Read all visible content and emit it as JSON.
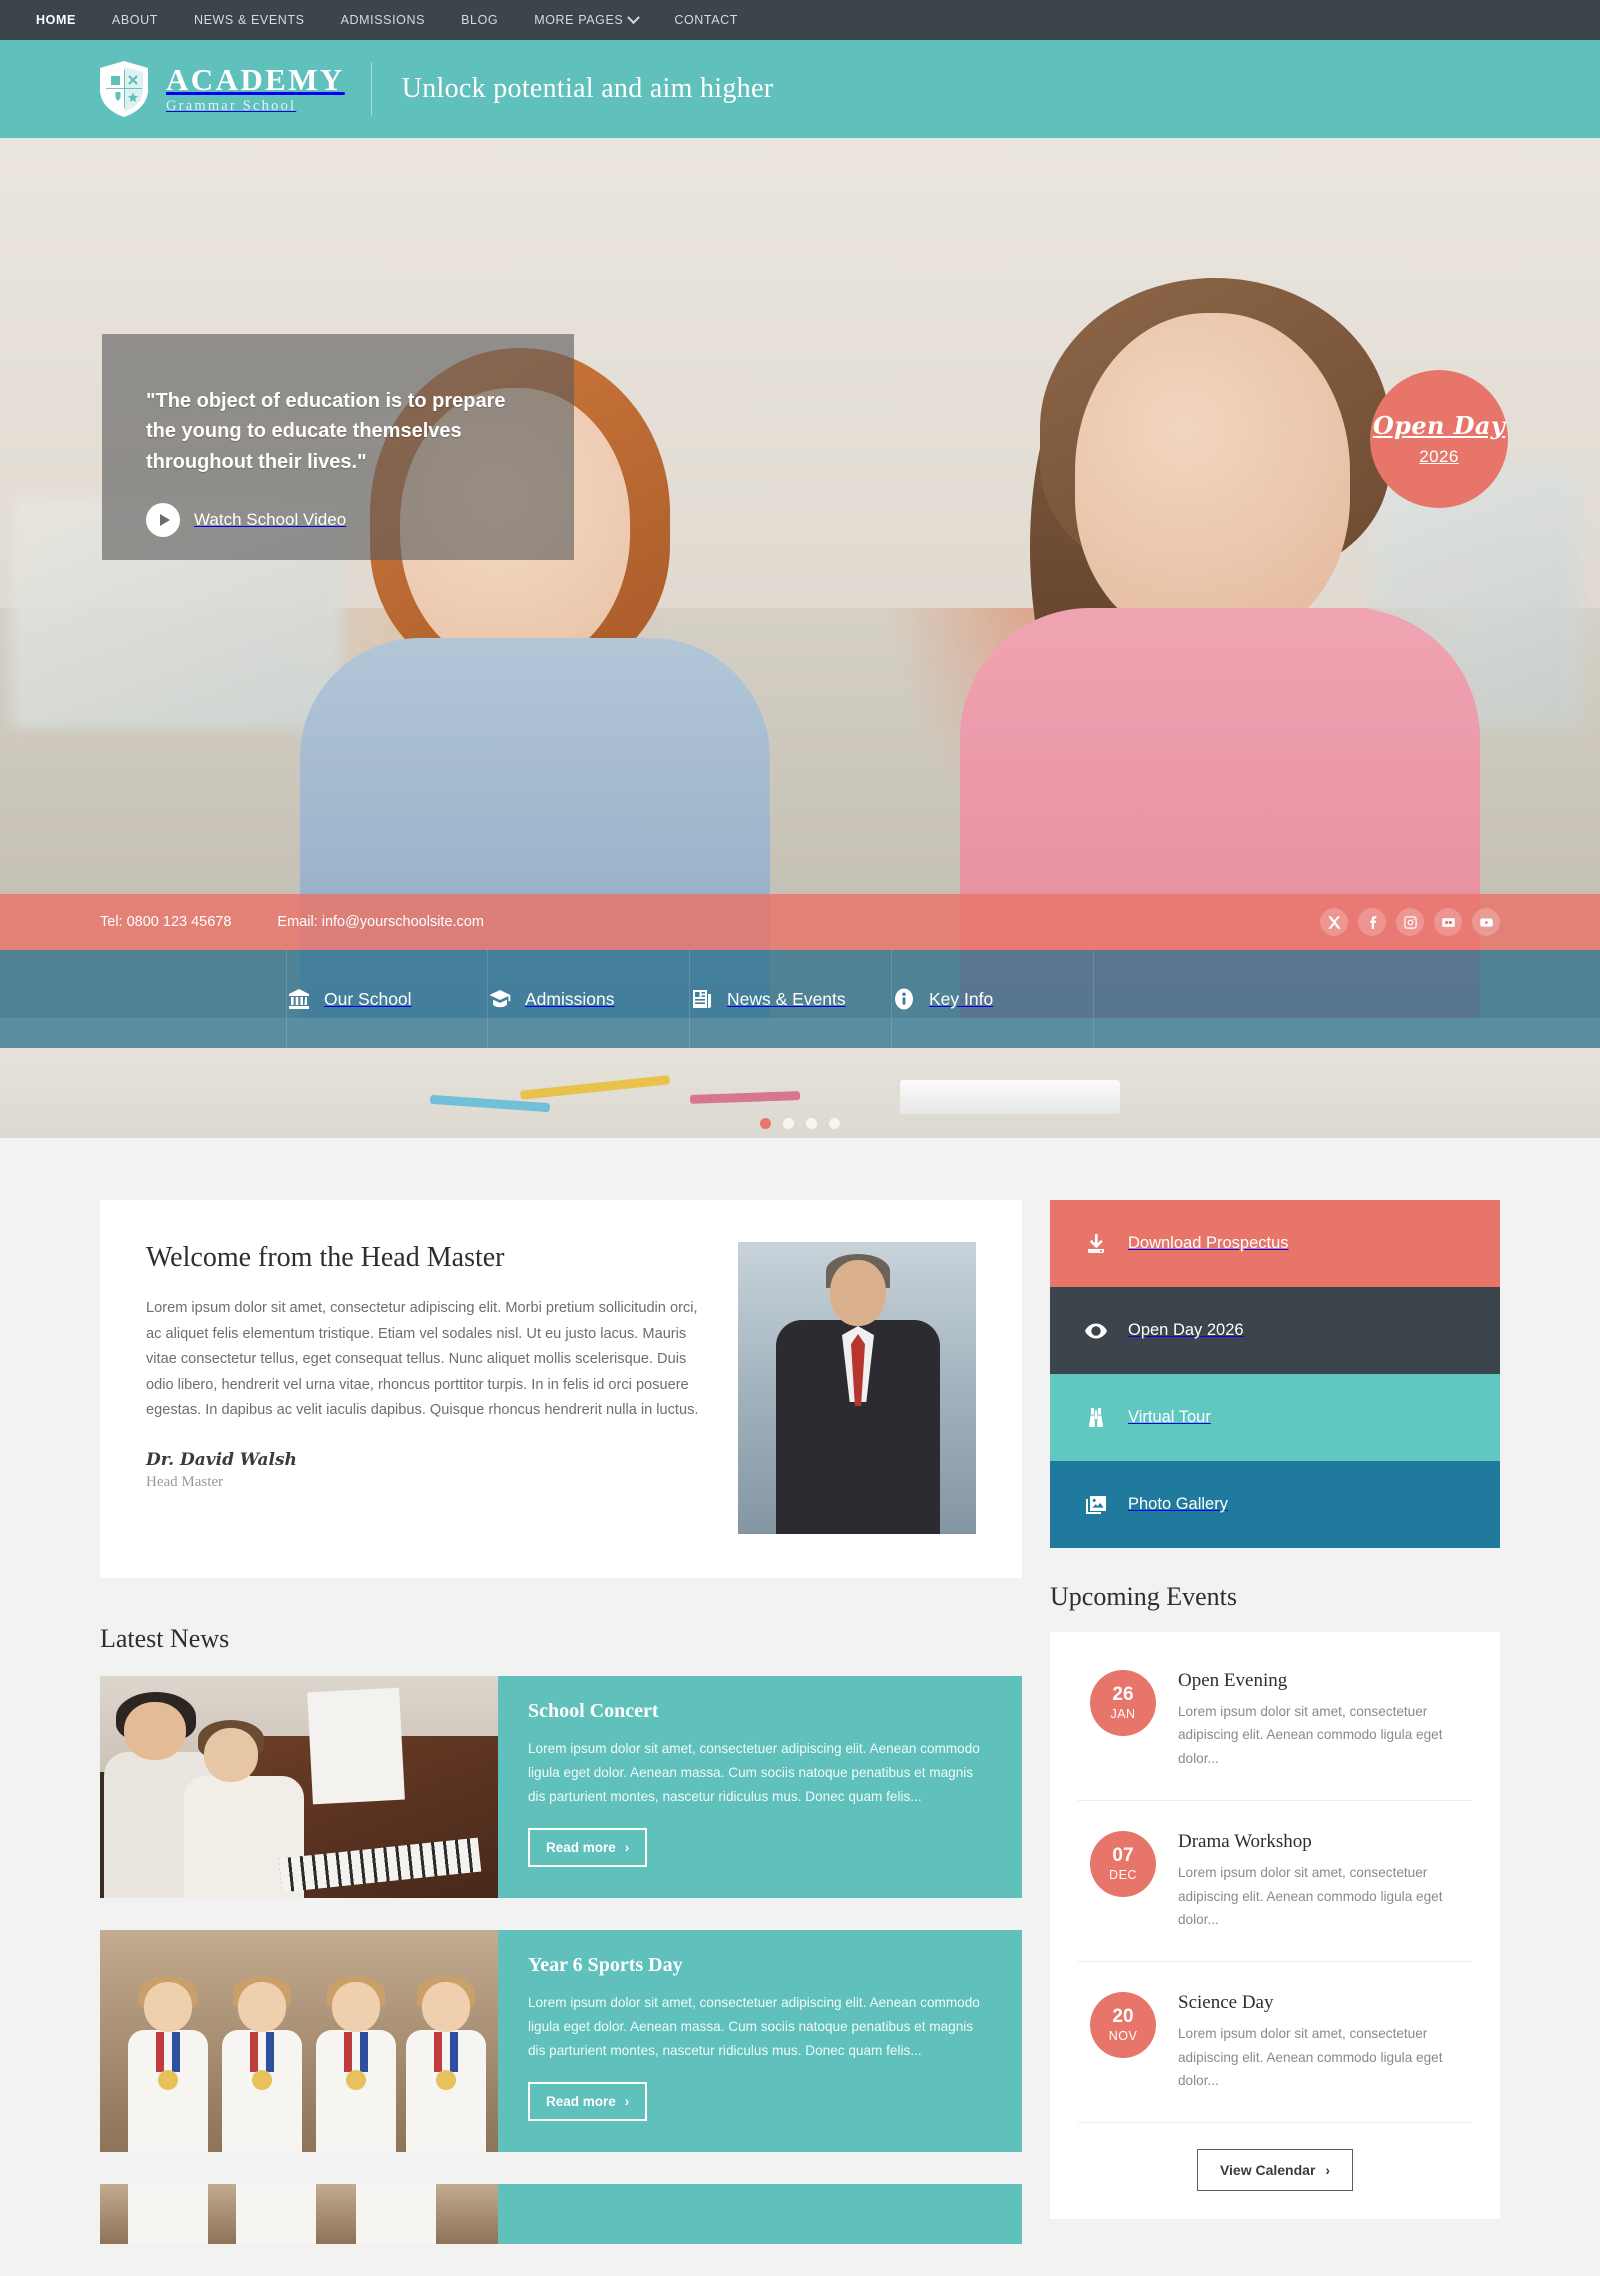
{
  "topnav": {
    "items": [
      {
        "label": "HOME",
        "active": true
      },
      {
        "label": "ABOUT",
        "active": false
      },
      {
        "label": "NEWS & EVENTS",
        "active": false
      },
      {
        "label": "ADMISSIONS",
        "active": false
      },
      {
        "label": "BLOG",
        "active": false
      },
      {
        "label": "MORE PAGES",
        "active": false,
        "caret": true
      },
      {
        "label": "CONTACT",
        "active": false
      }
    ]
  },
  "brand": {
    "name": "ACADEMY",
    "sub": "Grammar School",
    "tagline": "Unlock potential and aim higher"
  },
  "hero": {
    "quote": "\"The object of education is to prepare the young to educate themselves throughout their lives.\"",
    "watch_label": "Watch School Video",
    "badge_title": "Open Day",
    "badge_year": "2026",
    "dots": 4,
    "active_dot": 0
  },
  "contactbar": {
    "tel": "Tel: 0800 123 45678",
    "email": "Email: info@yourschoolsite.com",
    "socials": [
      "x-icon",
      "facebook-icon",
      "instagram-icon",
      "flickr-icon",
      "youtube-icon"
    ]
  },
  "quicknav": {
    "items": [
      {
        "label": "Our School",
        "icon": "bank-icon"
      },
      {
        "label": "Admissions",
        "icon": "graduation-cap-icon"
      },
      {
        "label": "News & Events",
        "icon": "newspaper-icon"
      },
      {
        "label": "Key Info",
        "icon": "info-icon"
      }
    ]
  },
  "welcome": {
    "title": "Welcome from the Head Master",
    "body": "Lorem ipsum dolor sit amet, consectetur adipiscing elit. Morbi pretium sollicitudin orci, ac aliquet felis elementum tristique. Etiam vel sodales nisl. Ut eu justo lacus. Mauris vitae consectetur tellus, eget consequat tellus. Nunc aliquet mollis scelerisque. Duis odio libero, hendrerit vel urna vitae, rhoncus porttitor turpis. In in felis id orci posuere egestas. In dapibus ac velit iaculis dapibus. Quisque rhoncus hendrerit nulla in luctus.",
    "signature": "Dr. David Walsh",
    "role": "Head Master"
  },
  "actions": [
    {
      "label": "Download Prospectus",
      "icon": "download-icon",
      "color": "#e8756a"
    },
    {
      "label": "Open Day 2026",
      "icon": "eye-icon",
      "color": "#3c444c"
    },
    {
      "label": "Virtual Tour",
      "icon": "binoculars-icon",
      "color": "#60c8c0"
    },
    {
      "label": "Photo Gallery",
      "icon": "photo-icon",
      "color": "#1f7a9e"
    }
  ],
  "news": {
    "title": "Latest News",
    "read_more": "Read more",
    "items": [
      {
        "title": "School Concert",
        "excerpt": "Lorem ipsum dolor sit amet, consectetuer adipiscing elit. Aenean commodo ligula eget dolor. Aenean massa. Cum sociis natoque penatibus et magnis dis parturient montes, nascetur ridiculus mus. Donec quam felis..."
      },
      {
        "title": "Year 6 Sports Day",
        "excerpt": "Lorem ipsum dolor sit amet, consectetuer adipiscing elit. Aenean commodo ligula eget dolor. Aenean massa. Cum sociis natoque penatibus et magnis dis parturient montes, nascetur ridiculus mus. Donec quam felis..."
      }
    ]
  },
  "events": {
    "title": "Upcoming Events",
    "calendar_label": "View Calendar",
    "items": [
      {
        "day": "26",
        "month": "JAN",
        "title": "Open Evening",
        "excerpt": "Lorem ipsum dolor sit amet, consectetuer adipiscing elit. Aenean commodo ligula eget dolor..."
      },
      {
        "day": "07",
        "month": "DEC",
        "title": "Drama Workshop",
        "excerpt": "Lorem ipsum dolor sit amet, consectetuer adipiscing elit. Aenean commodo ligula eget dolor..."
      },
      {
        "day": "20",
        "month": "NOV",
        "title": "Science Day",
        "excerpt": "Lorem ipsum dolor sit amet, consectetuer adipiscing elit. Aenean commodo ligula eget dolor..."
      }
    ]
  },
  "colors": {
    "teal": "#60c0bc",
    "salmon": "#e8756a",
    "dark": "#3c444c",
    "blue": "#1f7a9e",
    "page_bg": "#f2f2f2"
  }
}
